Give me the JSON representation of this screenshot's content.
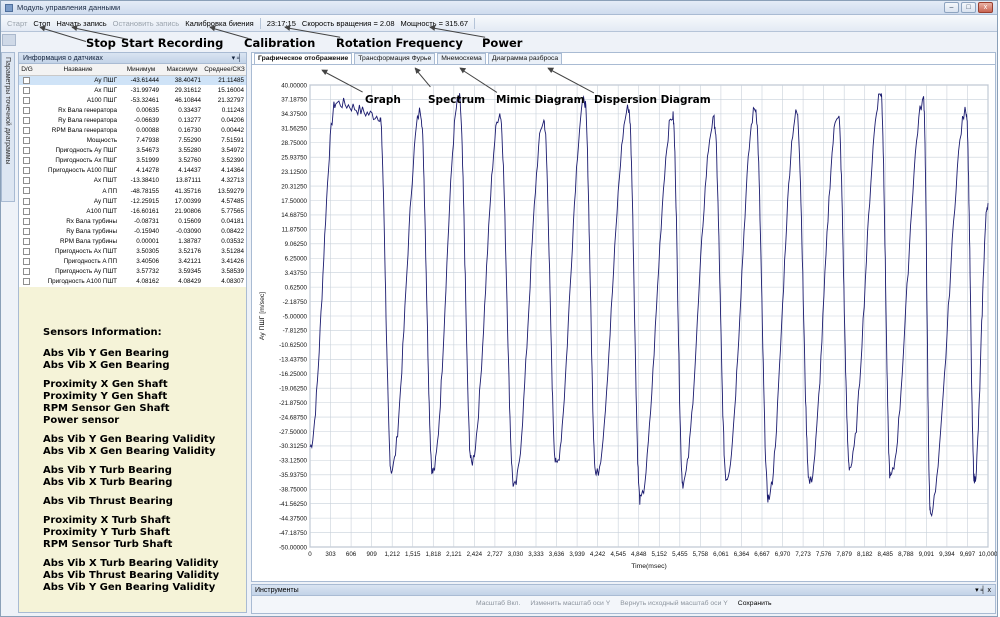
{
  "window": {
    "title": "Модуль управления данными",
    "controls": {
      "minimize": "–",
      "maximize": "□",
      "close": "x"
    }
  },
  "toolbar": {
    "start": "Старт",
    "stop": "Стоп",
    "start_recording": "Начать запись",
    "stop_recording": "Остановить запись",
    "calibration": "Калибровка биения",
    "time": "23:17:15",
    "rotation": "Скорость вращения = 2.08",
    "power": "Мощность = 315.67"
  },
  "annotations": {
    "stop": "Stop",
    "start_recording": "Start Recording",
    "calibration": "Calibration",
    "rotation_frequency": "Rotation Frequency",
    "power": "Power",
    "graph": "Graph",
    "spectrum": "Spectrum",
    "mimic_diagram": "Mimic Diagram",
    "dispersion_diagram": "Dispersion Diagram"
  },
  "side_tab": {
    "label": "Параметры точечной диаграммы"
  },
  "sensor_panel": {
    "title": "Информация о датчиках",
    "pin": "▾ ╡",
    "columns": [
      "D/G",
      "Название",
      "Минимум",
      "Максимум",
      "Среднее/СКЗ"
    ],
    "rows": [
      {
        "name": "Ay ПШГ",
        "min": "-43.61444",
        "max": "38.40471",
        "avg": "21.11485"
      },
      {
        "name": "Ax ПШГ",
        "min": "-31.99749",
        "max": "29.31612",
        "avg": "15.16004"
      },
      {
        "name": "A100 ПШГ",
        "min": "-53.32461",
        "max": "46.10844",
        "avg": "21.32797"
      },
      {
        "name": "Rx Вала генератора",
        "min": "0.00635",
        "max": "0.33437",
        "avg": "0.11243"
      },
      {
        "name": "Ry Вала генератора",
        "min": "-0.06639",
        "max": "0.13277",
        "avg": "0.04206"
      },
      {
        "name": "RPM Вала генератора",
        "min": "0.00088",
        "max": "0.16730",
        "avg": "0.00442"
      },
      {
        "name": "Мощность",
        "min": "7.47938",
        "max": "7.55290",
        "avg": "7.51591"
      },
      {
        "name": "Пригодность Ay ПШГ",
        "min": "3.54673",
        "max": "3.55280",
        "avg": "3.54972"
      },
      {
        "name": "Пригодность Ax ПШГ",
        "min": "3.51999",
        "max": "3.52760",
        "avg": "3.52390"
      },
      {
        "name": "Пригодность A100 ПШГ",
        "min": "4.14278",
        "max": "4.14437",
        "avg": "4.14364"
      },
      {
        "name": "Ax ПШТ",
        "min": "-13.38410",
        "max": "13.87111",
        "avg": "4.32713"
      },
      {
        "name": "A ПП",
        "min": "-48.78155",
        "max": "41.35716",
        "avg": "13.59279"
      },
      {
        "name": "Ay ПШТ",
        "min": "-12.25915",
        "max": "17.00399",
        "avg": "4.57485"
      },
      {
        "name": "A100 ПШТ",
        "min": "-16.60161",
        "max": "21.90806",
        "avg": "5.77565"
      },
      {
        "name": "Rx Вала турбины",
        "min": "-0.08731",
        "max": "0.15609",
        "avg": "0.04181"
      },
      {
        "name": "Ry Вала турбины",
        "min": "-0.15940",
        "max": "-0.03090",
        "avg": "0.08422"
      },
      {
        "name": "RPM Вала турбины",
        "min": "0.00001",
        "max": "1.38787",
        "avg": "0.03532"
      },
      {
        "name": "Пригодность Ax ПШТ",
        "min": "3.50305",
        "max": "3.52176",
        "avg": "3.51284"
      },
      {
        "name": "Пригодность A ПП",
        "min": "3.40506",
        "max": "3.42121",
        "avg": "3.41426"
      },
      {
        "name": "Пригодность Ay ПШТ",
        "min": "3.57732",
        "max": "3.59345",
        "avg": "3.58539"
      },
      {
        "name": "Пригодность A100 ПШТ",
        "min": "4.08162",
        "max": "4.08429",
        "avg": "4.08307"
      }
    ]
  },
  "sensor_info": {
    "title": "Sensors Information:",
    "groups": [
      [
        "Abs Vib Y Gen Bearing",
        "Abs Vib X Gen Bearing"
      ],
      [
        "Proximity X Gen Shaft",
        "Proximity Y Gen Shaft",
        "RPM Sensor Gen Shaft",
        "Power sensor"
      ],
      [
        "Abs Vib Y Gen Bearing Validity",
        "Abs Vib X Gen Bearing Validity"
      ],
      [
        "Abs Vib Y Turb Bearing",
        "Abs Vib X Turb Bearing"
      ],
      [
        "Abs Vib Thrust Bearing"
      ],
      [
        "Proximity X Turb Shaft",
        "Proximity Y Turb Shaft",
        "RPM Sensor Turb Shaft"
      ],
      [
        "Abs Vib X Turb Bearing Validity",
        "Abs Vib Thrust Bearing Validity",
        "Abs Vib Y Gen Bearing Validity"
      ]
    ]
  },
  "tabs": [
    {
      "label": "Графическое отображение",
      "active": true
    },
    {
      "label": "Трансформация Фурье",
      "active": false
    },
    {
      "label": "Мнемосхема",
      "active": false
    },
    {
      "label": "Диаграмма разброса",
      "active": false
    }
  ],
  "chart_data": {
    "type": "line",
    "xlabel": "Time(msec)",
    "ylabel": "Ay ПШГ [m/sec]",
    "xlim": [
      0,
      10000
    ],
    "ylim": [
      -50,
      40
    ],
    "x_ticks": [
      "0",
      "303",
      "606",
      "909",
      "1,212",
      "1,515",
      "1,818",
      "2,121",
      "2,424",
      "2,727",
      "3,030",
      "3,333",
      "3,636",
      "3,939",
      "4,242",
      "4,545",
      "4,848",
      "5,152",
      "5,455",
      "5,758",
      "6,061",
      "6,364",
      "6,667",
      "6,970",
      "7,273",
      "7,576",
      "7,879",
      "8,182",
      "8,485",
      "8,788",
      "9,091",
      "9,394",
      "9,697",
      "10,000"
    ],
    "y_ticks": [
      "40.00000",
      "37.18750",
      "34.37500",
      "31.56250",
      "28.75000",
      "25.93750",
      "23.12500",
      "20.31250",
      "17.50000",
      "14.68750",
      "11.87500",
      "9.06250",
      "6.25000",
      "3.43750",
      "0.62500",
      "-2.18750",
      "-5.00000",
      "-7.81250",
      "-10.62500",
      "-13.43750",
      "-16.25000",
      "-19.06250",
      "-21.87500",
      "-24.68750",
      "-27.50000",
      "-30.31250",
      "-33.12500",
      "-35.93750",
      "-38.75000",
      "-41.56250",
      "-44.37500",
      "-47.18750",
      "-50.00000"
    ],
    "grid": true,
    "series": [
      {
        "name": "",
        "color": "#1a1a6e",
        "cycles": [
          {
            "t_max": 380,
            "max": 36.5,
            "t_min": 0,
            "min": -30.5
          },
          {
            "t_max": 1030,
            "max": 34.0,
            "t_min": 1200,
            "min": -35.0
          },
          {
            "t_max": 1630,
            "max": 35.0,
            "t_min": 1810,
            "min": -35.5
          },
          {
            "t_max": 2200,
            "max": 37.5,
            "t_min": 2380,
            "min": -33.5
          },
          {
            "t_max": 2800,
            "max": 34.5,
            "t_min": 3010,
            "min": -38.5
          },
          {
            "t_max": 3450,
            "max": 33.0,
            "t_min": 3630,
            "min": -34.0
          },
          {
            "t_max": 4050,
            "max": 37.0,
            "t_min": 4220,
            "min": -36.0
          },
          {
            "t_max": 4700,
            "max": 35.5,
            "t_min": 4870,
            "min": -41.0
          },
          {
            "t_max": 5350,
            "max": 34.0,
            "t_min": 5500,
            "min": -37.5
          },
          {
            "t_max": 5960,
            "max": 33.0,
            "t_min": 6140,
            "min": -36.5
          },
          {
            "t_max": 6570,
            "max": 35.5,
            "t_min": 6760,
            "min": -40.5
          },
          {
            "t_max": 7180,
            "max": 34.5,
            "t_min": 7370,
            "min": -37.5
          },
          {
            "t_max": 7790,
            "max": 34.5,
            "t_min": 7960,
            "min": -34.5
          },
          {
            "t_max": 8420,
            "max": 38.5,
            "t_min": 8560,
            "min": -36.5
          },
          {
            "t_max": 9050,
            "max": 37.0,
            "t_min": 9150,
            "min": -43.0
          },
          {
            "t_max": 9680,
            "max": 35.0,
            "t_min": 9800,
            "min": -37.0
          }
        ]
      }
    ]
  },
  "tools_panel": {
    "title": "Инструменты",
    "pin": "▾ ╡ x",
    "items": [
      {
        "label": "Масштаб Вкл.",
        "enabled": false
      },
      {
        "label": "Изменить масштаб оси Y",
        "enabled": false
      },
      {
        "label": "Вернуть исходный масштаб оси Y",
        "enabled": false
      },
      {
        "label": "Сохранить",
        "enabled": true
      }
    ]
  }
}
